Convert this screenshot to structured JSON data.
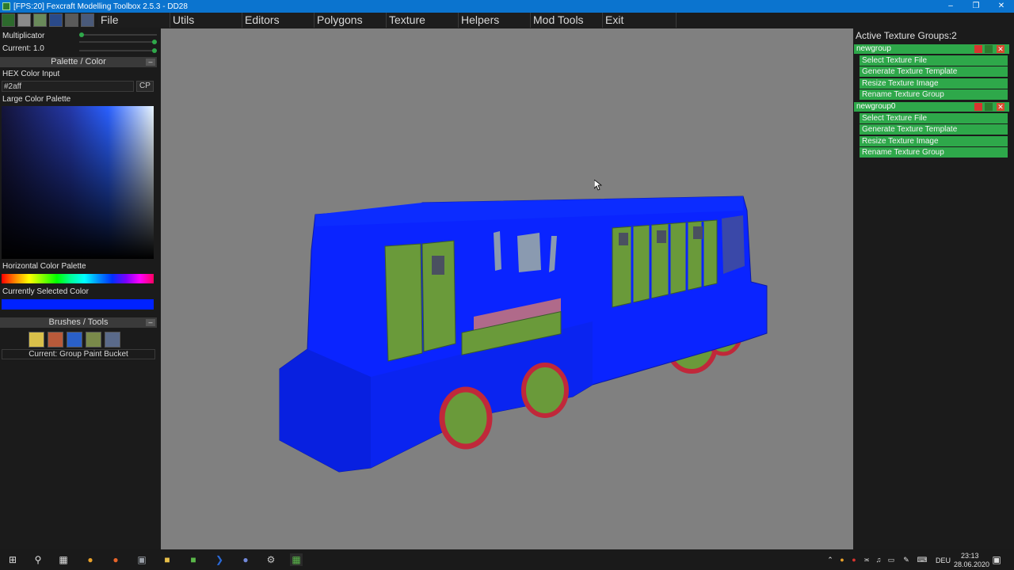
{
  "window": {
    "title": "[FPS:20] Fexcraft Modelling Toolbox 2.5.3 - DD28"
  },
  "menu": {
    "items": [
      "File",
      "Utils",
      "Editors",
      "Polygons",
      "Texture",
      "Helpers",
      "Mod Tools",
      "Exit"
    ]
  },
  "left_panel": {
    "multiplicator_label": "Multiplicator",
    "current_label": "Current: 1.0",
    "multiplicator_level": 0.0,
    "current_level": 1.0,
    "palette_header": "Palette / Color",
    "hex_label": "HEX Color Input",
    "hex_value": "#2aff",
    "cp_label": "CP",
    "large_palette_label": "Large Color Palette",
    "horizontal_palette_label": "Horizontal Color Palette",
    "selected_color_label": "Currently Selected Color",
    "selected_color": "#0022ff",
    "brushes_header": "Brushes / Tools",
    "brush_icons": [
      "pencil-icon",
      "paint-roller-icon",
      "cube-icon",
      "group-bucket-icon",
      "eyedropper-icon"
    ],
    "current_tool": "Current: Group Paint Bucket"
  },
  "right_panel": {
    "title": "Active Texture Groups:2",
    "groups": [
      {
        "name": "newgroup",
        "actions": [
          "Select Texture File",
          "Generate Texture Template",
          "Resize Texture Image",
          "Rename Texture Group"
        ]
      },
      {
        "name": "newgroup0",
        "actions": [
          "Select Texture File",
          "Generate Texture Template",
          "Resize Texture Image",
          "Rename Texture Group"
        ]
      }
    ]
  },
  "taskbar": {
    "language": "DEU",
    "time": "23:13",
    "date": "28.06.2020"
  },
  "colors": {
    "model_body": "#0a24ff",
    "model_accent": "#6a9a3a",
    "wheel_red": "#c0283a",
    "group_green": "#2ea84a",
    "viewport_bg": "#808080"
  }
}
